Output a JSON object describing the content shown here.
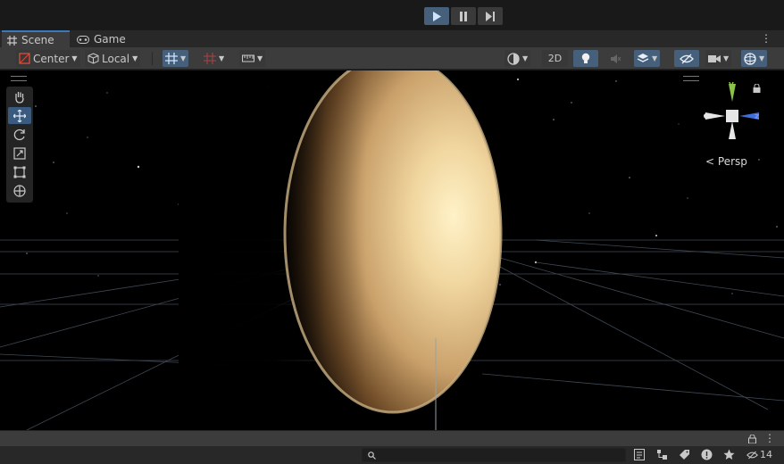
{
  "playbar": {
    "controls": [
      "play-icon",
      "pause-icon",
      "step-icon"
    ],
    "active": "play-icon"
  },
  "tabs": [
    {
      "label": "Scene",
      "icon": "grid-icon",
      "active": true
    },
    {
      "label": "Game",
      "icon": "gamepad-icon",
      "active": false
    }
  ],
  "toolbar": {
    "pivot_label": "Center",
    "space_label": "Local",
    "mode_2d_label": "2D"
  },
  "scene": {
    "projection_label": "Persp",
    "gizmo_axes": [
      "y",
      "z"
    ],
    "subject": "planet"
  },
  "status": {
    "hidden_count": "14"
  },
  "colors": {
    "accent": "#3a79bb",
    "active_button": "#46607c",
    "axis_y": "#8bc34a",
    "axis_z": "#3f6fd8",
    "planet_light": "#f4dcaa",
    "planet_dark": "#6b4a25"
  }
}
